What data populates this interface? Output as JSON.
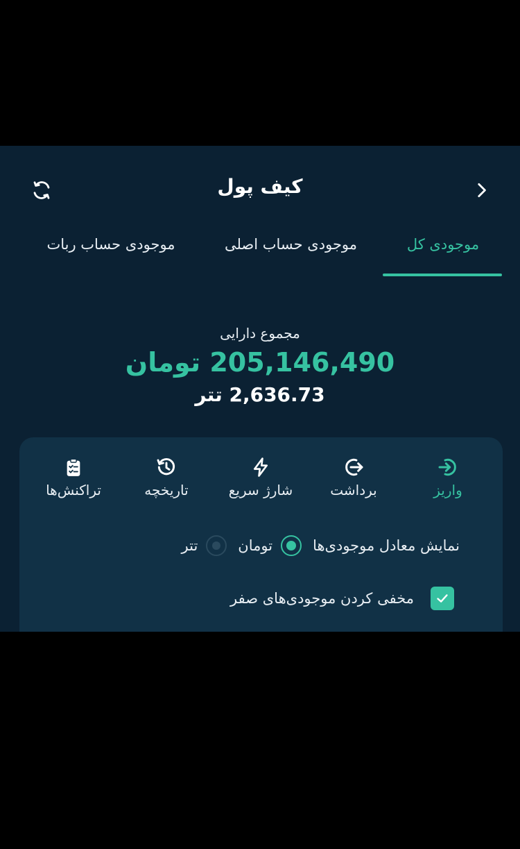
{
  "header": {
    "title": "کیف پول",
    "refresh_icon": "refresh-icon",
    "back_icon": "chevron-right-icon"
  },
  "tabs": [
    {
      "label": "موجودی کل",
      "active": true
    },
    {
      "label": "موجودی حساب اصلی",
      "active": false
    },
    {
      "label": "موجودی حساب ربات",
      "active": false
    }
  ],
  "summary": {
    "label": "مجموع دارایی",
    "toman": "205,146,490 تومان",
    "usdt": "2,636.73 تتر"
  },
  "actions": [
    {
      "label": "واریز",
      "icon": "deposit-icon"
    },
    {
      "label": "برداشت",
      "icon": "withdraw-icon"
    },
    {
      "label": "شارژ سریع",
      "icon": "lightning-icon"
    },
    {
      "label": "تاریخچه",
      "icon": "history-icon"
    },
    {
      "label": "تراکنش‌ها",
      "icon": "clipboard-icon"
    }
  ],
  "equivalent": {
    "label": "نمایش معادل موجودی‌ها",
    "options": [
      {
        "label": "تومان",
        "selected": true
      },
      {
        "label": "تتر",
        "selected": false
      }
    ]
  },
  "hide_zero": {
    "label": "مخفی کردن موجودی‌های صفر",
    "checked": true
  },
  "colors": {
    "background": "#0b2133",
    "card": "#113146",
    "accent": "#36c2a1",
    "text": "#e8eef3"
  }
}
